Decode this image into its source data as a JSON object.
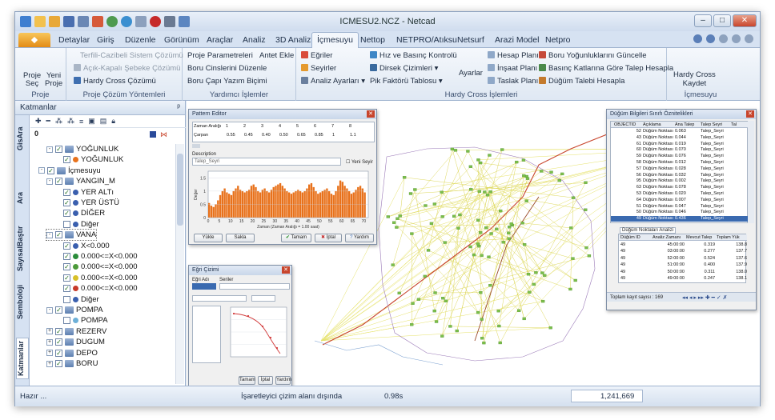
{
  "window": {
    "title": "ICMESU2.NCZ - Netcad",
    "minimize": "–",
    "maximize": "□",
    "close": "✕"
  },
  "tabs": [
    "Detaylar",
    "Giriş",
    "Düzenle",
    "Görünüm",
    "Araçlar",
    "Analiz",
    "3D Analiz",
    "İçmesuyu",
    "Nettop",
    "NETPRO/Atıksu",
    "Netsurf",
    "Arazi Model",
    "Netpro"
  ],
  "active_tab": "İçmesuyu",
  "ribbon": {
    "proje": {
      "seç": "Proje Seç",
      "yeni": "Yeni Proje",
      "label": "Proje",
      "seç1": "Proje",
      "seç2": "Seç",
      "yeni1": "Yeni",
      "yeni2": "Proje"
    },
    "cozum": {
      "label": "Proje Çözüm Yöntemleri",
      "items": [
        "Terfili-Cazibeli Sistem Çözümü",
        "Açık-Kapalı Şebeke Çözümü",
        "Hardy Cross Çözümü"
      ]
    },
    "yardimci": {
      "label": "Yardımcı İşlemler",
      "items": [
        "Proje Parametreleri",
        "Boru Cinslerini Düzenle",
        "Boru Çapı Yazım Biçimi",
        "Antet Ekle"
      ]
    },
    "hardy": {
      "label": "Hardy Cross İşlemleri",
      "col1": [
        "Eğriler",
        "Seyirler",
        "Analiz Ayarları"
      ],
      "col2": [
        "Hız ve Basınç Kontrolü",
        "Dirsek Çizimleri",
        "Pik Faktörü Tablosu"
      ],
      "ayarlar": "Ayarlar",
      "col3": [
        "Hesap Planı",
        "İnşaat Planı",
        "Taslak Planı"
      ],
      "col4": [
        "Boru Yoğunluklarını Güncelle",
        "Basınç Katlarına Göre Talep Hesapla",
        "Düğüm Talebi Hesapla"
      ]
    },
    "icmesuyu": {
      "label": "İçmesuyu",
      "kaydet": "Hardy Cross Kaydet",
      "kaydet1": "Hardy Cross",
      "kaydet2": "Kaydet"
    }
  },
  "leftpanel": {
    "title": "Katmanlar",
    "pin": "ᵖ",
    "vtabs": [
      "GisAra",
      "Ara",
      "SayısalBaştır",
      "Semboloji",
      "Katmanlar"
    ],
    "zero": "0",
    "tree": [
      {
        "label": "YOĞUNLUK",
        "level": 2,
        "exp": "-",
        "checked": true,
        "icon": "sq"
      },
      {
        "label": "YOĞUNLUK",
        "level": 3,
        "checked": true,
        "icon": "dot",
        "color": "#e8721c"
      },
      {
        "label": "İçmesuyu",
        "level": 1,
        "exp": "-",
        "checked": true,
        "icon": "sq"
      },
      {
        "label": "YANGIN_M",
        "level": 2,
        "exp": "-",
        "checked": true,
        "icon": "sq"
      },
      {
        "label": "YER ALTı",
        "level": 3,
        "checked": true,
        "icon": "dot",
        "color": "#3a5fae"
      },
      {
        "label": "YER ÜSTÜ",
        "level": 3,
        "checked": true,
        "icon": "dot",
        "color": "#3a5fae"
      },
      {
        "label": "DİĞER",
        "level": 3,
        "checked": true,
        "icon": "dot",
        "color": "#3a5fae"
      },
      {
        "label": "Diğer",
        "level": 3,
        "checked": false,
        "icon": "dot",
        "color": "#3a5fae"
      },
      {
        "label": "VANA",
        "level": 2,
        "exp": "-",
        "checked": true,
        "icon": "sq"
      },
      {
        "label": "X<0.000",
        "level": 3,
        "checked": true,
        "icon": "dot",
        "color": "#3a5fae"
      },
      {
        "label": "0.000<=X<0.000",
        "level": 3,
        "checked": true,
        "icon": "dot",
        "color": "#2a8c3a"
      },
      {
        "label": "0.000<=X<0.000",
        "level": 3,
        "checked": true,
        "icon": "dot",
        "color": "#4c9a3a"
      },
      {
        "label": "0.000<=X<0.000",
        "level": 3,
        "checked": true,
        "icon": "dot",
        "color": "#d8c028"
      },
      {
        "label": "0.000<=X<0.000",
        "level": 3,
        "checked": true,
        "icon": "dot",
        "color": "#c83a2a"
      },
      {
        "label": "Diğer",
        "level": 3,
        "checked": false,
        "icon": "dot",
        "color": "#3a5fae"
      },
      {
        "label": "POMPA",
        "level": 2,
        "exp": "-",
        "checked": true,
        "icon": "sq"
      },
      {
        "label": "POMPA",
        "level": 3,
        "checked": false,
        "icon": "dot",
        "color": "#6db0d8"
      },
      {
        "label": "REZERV",
        "level": 2,
        "exp": "+",
        "checked": true,
        "icon": "sq"
      },
      {
        "label": "DUGUM",
        "level": 2,
        "exp": "+",
        "checked": true,
        "icon": "sq"
      },
      {
        "label": "DEPO",
        "level": 2,
        "exp": "+",
        "checked": true,
        "icon": "sq"
      },
      {
        "label": "BORU",
        "level": 2,
        "exp": "+",
        "checked": true,
        "icon": "sq"
      }
    ]
  },
  "pattern_editor": {
    "title": "Pattern Editor",
    "headers": [
      "Zaman Aralığı",
      "1",
      "2",
      "3",
      "4",
      "5",
      "6",
      "7",
      "8"
    ],
    "row_label": "Çarpan",
    "row_values": [
      "0.55",
      "0.45",
      "0.40",
      "0.50",
      "0.65",
      "0.85",
      "1",
      "1.1"
    ],
    "desc_label": "Description",
    "desc_value": "Talep_Seyri",
    "yeni_seyir": "Yeni Seyir",
    "ylabel": "Değer",
    "xlabel": "Zaman (Zaman Aralığı = 1.00 saat)",
    "buttons": [
      "Yükle",
      "Sakla",
      "Tamam",
      "İptal",
      "Yardım"
    ]
  },
  "pattern_chart_data": {
    "type": "bar",
    "x_ticks": [
      0,
      5,
      10,
      15,
      20,
      25,
      30,
      35,
      40,
      45,
      50,
      55,
      60,
      65,
      70
    ],
    "y_ticks": [
      "0",
      "0.5",
      "1",
      "1.5"
    ],
    "ylim": [
      0,
      1.75
    ],
    "values": [
      0.55,
      0.45,
      0.4,
      0.5,
      0.65,
      0.85,
      1.0,
      1.1,
      0.95,
      0.9,
      0.85,
      1.0,
      1.1,
      1.2,
      1.05,
      1.0,
      0.95,
      1.0,
      1.05,
      1.2,
      1.25,
      1.15,
      1.0,
      0.95,
      1.05,
      1.1,
      1.0,
      0.95,
      1.05,
      1.15,
      1.2,
      1.25,
      1.3,
      1.2,
      1.1,
      1.0,
      0.95,
      0.9,
      0.95,
      1.0,
      1.05,
      1.0,
      0.95,
      1.0,
      1.1,
      1.25,
      1.3,
      1.15,
      1.0,
      0.9,
      0.95,
      1.0,
      1.05,
      1.1,
      1.0,
      0.9,
      0.85,
      1.0,
      1.2,
      1.4,
      1.35,
      1.2,
      1.1,
      1.0,
      0.9,
      0.95,
      1.05,
      1.15,
      1.2,
      1.1,
      0.95
    ]
  },
  "egri_dialog": {
    "title": "Eğri Çizimi",
    "labels": [
      "Eğri Adı",
      "Seriler"
    ],
    "buttons": [
      "Tamam",
      "İptal",
      "Yardım"
    ]
  },
  "node_table": {
    "title": "Düğüm Bilgileri Sınıfı Öznitelikleri",
    "headers": [
      "OBJECTID",
      "Açıklama",
      "Ana Talep",
      "Talep Seyri",
      "Tal"
    ],
    "rows": [
      [
        "52",
        "Düğüm Noktası",
        "0.063",
        "Talep_Seyri"
      ],
      [
        "43",
        "Düğüm Noktası",
        "0.044",
        "Talep_Seyri"
      ],
      [
        "61",
        "Düğüm Noktası",
        "0.019",
        "Talep_Seyri"
      ],
      [
        "60",
        "Düğüm Noktası",
        "0.070",
        "Talep_Seyri"
      ],
      [
        "59",
        "Düğüm Noktası",
        "0.076",
        "Talep_Seyri"
      ],
      [
        "58",
        "Düğüm Noktası",
        "0.012",
        "Talep_Seyri"
      ],
      [
        "57",
        "Düğüm Noktası",
        "0.028",
        "Talep_Seyri"
      ],
      [
        "56",
        "Düğüm Noktası",
        "0.032",
        "Talep_Seyri"
      ],
      [
        "95",
        "Düğüm Noktası",
        "0.002",
        "Talep_Seyri"
      ],
      [
        "63",
        "Düğüm Noktası",
        "0.078",
        "Talep_Seyri"
      ],
      [
        "53",
        "Düğüm Noktası",
        "0.020",
        "Talep_Seyri"
      ],
      [
        "64",
        "Düğüm Noktası",
        "0.007",
        "Talep_Seyri"
      ],
      [
        "51",
        "Düğüm Noktası",
        "0.047",
        "Talep_Seyri"
      ],
      [
        "50",
        "Düğüm Noktası",
        "0.046",
        "Talep_Seyri"
      ],
      [
        "49",
        "Düğüm Noktası",
        "0.436",
        "Talep_Seyri"
      ]
    ],
    "selected_row": 14,
    "subtab": "Düğüm Noktaları Analizi",
    "sub_headers": [
      "Düğüm ID",
      "Analiz Zamanı",
      "Mevcut Talep",
      "Toplam Yük"
    ],
    "sub_rows": [
      [
        "49",
        "45:00:00",
        "0.319",
        "138.8"
      ],
      [
        "49",
        "03:00:00",
        "0.277",
        "137.7"
      ],
      [
        "49",
        "52:00:00",
        "0.524",
        "137.6"
      ],
      [
        "49",
        "51:00:00",
        "0.400",
        "137.9"
      ],
      [
        "49",
        "50:00:00",
        "0.311",
        "138.0"
      ],
      [
        "49",
        "49:00:00",
        "0.247",
        "138.1"
      ]
    ],
    "footer": "Toplam kayıt sayısı : 169"
  },
  "status": {
    "hazir": "Hazır ...",
    "message": "İşaretleyici çizim alanı dışında",
    "time": "0.98s",
    "coords": "1,241,669"
  }
}
